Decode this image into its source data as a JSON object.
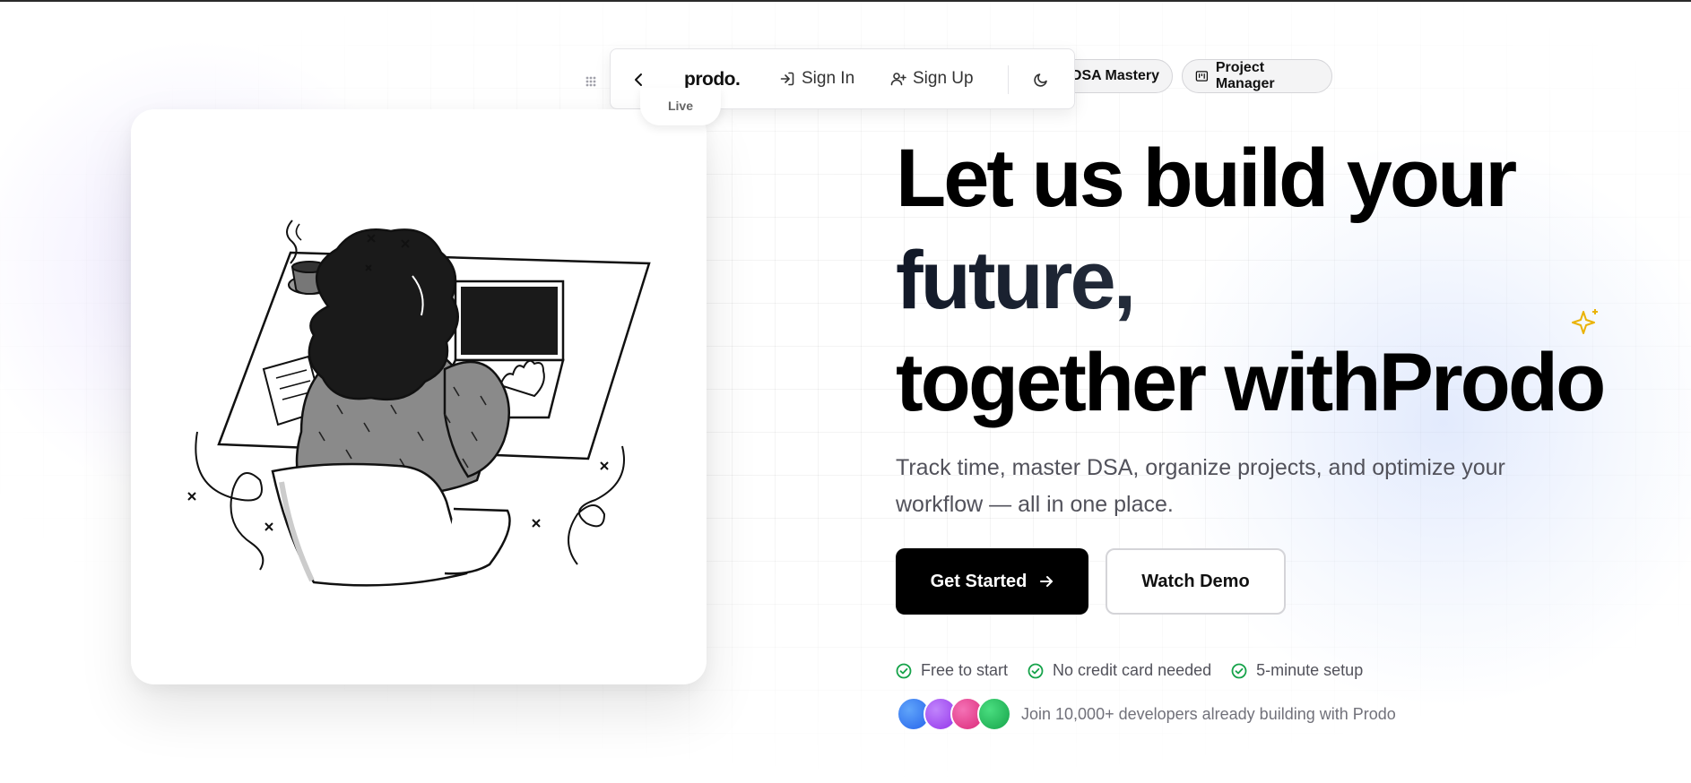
{
  "colors": {
    "accent_black": "#000000",
    "check_green": "#16a34a",
    "sparkle_gold": "#eab308",
    "avatar_colors": [
      "#3b82f6",
      "#a855f7",
      "#ec4899",
      "#22c55e"
    ]
  },
  "pills": [
    {
      "label": "DSA Mastery",
      "icon": "code-icon"
    },
    {
      "label": "Project Manager",
      "icon": "kanban-icon"
    }
  ],
  "navbar": {
    "logo": "prodo.",
    "sign_in": "Sign In",
    "sign_up": "Sign Up",
    "icons": [
      "grip-dots-icon",
      "chevron-left-icon",
      "sign-in-icon",
      "user-plus-icon",
      "moon-icon"
    ]
  },
  "illustration": {
    "tab_label": "Live"
  },
  "hero": {
    "title_line1": "Let us build your",
    "title_line2": "future,",
    "title_line3": "together withProdo",
    "subtitle": "Track time, master DSA, organize projects, and optimize your workflow — all in one place.",
    "primary_cta": "Get Started",
    "secondary_cta": "Watch Demo"
  },
  "features": [
    {
      "label": "Free to start"
    },
    {
      "label": "No credit card needed"
    },
    {
      "label": "5-minute setup"
    }
  ],
  "social_proof": {
    "text": "Join 10,000+ developers already building with Prodo"
  }
}
